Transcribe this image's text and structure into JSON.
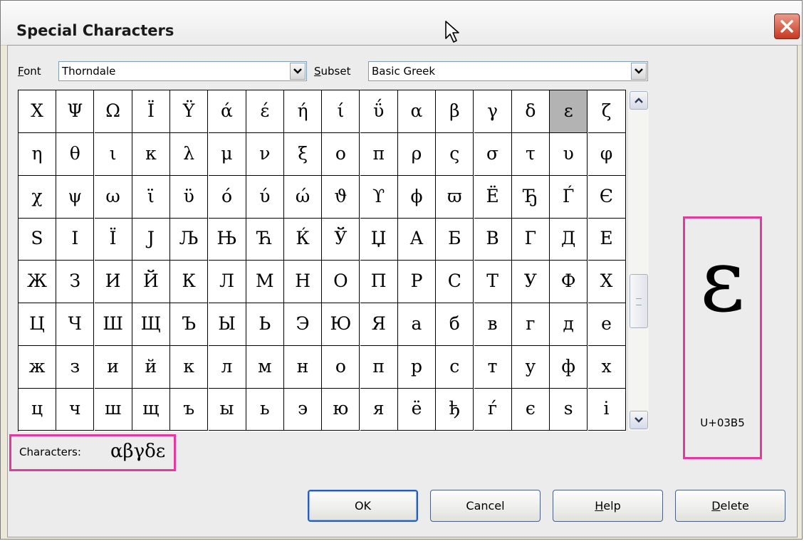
{
  "window": {
    "title": "Special Characters"
  },
  "font": {
    "label": "Font",
    "value": "Thorndale"
  },
  "subset": {
    "label": "Subset",
    "value": "Basic Greek"
  },
  "grid": {
    "rows": [
      [
        "Χ",
        "Ψ",
        "Ω",
        "Ϊ",
        "Ϋ",
        "ά",
        "έ",
        "ή",
        "ί",
        "ΰ",
        "α",
        "β",
        "γ",
        "δ",
        "ε",
        "ζ"
      ],
      [
        "η",
        "θ",
        "ι",
        "κ",
        "λ",
        "μ",
        "ν",
        "ξ",
        "ο",
        "π",
        "ρ",
        "ς",
        "σ",
        "τ",
        "υ",
        "φ"
      ],
      [
        "χ",
        "ψ",
        "ω",
        "ϊ",
        "ϋ",
        "ό",
        "ύ",
        "ώ",
        "ϑ",
        "ϒ",
        "ϕ",
        "ϖ",
        "Ё",
        "Ђ",
        "Ѓ",
        "Є"
      ],
      [
        "Ѕ",
        "І",
        "Ї",
        "Ј",
        "Љ",
        "Њ",
        "Ћ",
        "Ќ",
        "Ў",
        "Џ",
        "А",
        "Б",
        "В",
        "Г",
        "Д",
        "Е"
      ],
      [
        "Ж",
        "З",
        "И",
        "Й",
        "К",
        "Л",
        "М",
        "Н",
        "О",
        "П",
        "Р",
        "С",
        "Т",
        "У",
        "Ф",
        "Х"
      ],
      [
        "Ц",
        "Ч",
        "Ш",
        "Щ",
        "Ъ",
        "Ы",
        "Ь",
        "Э",
        "Ю",
        "Я",
        "а",
        "б",
        "в",
        "г",
        "д",
        "е"
      ],
      [
        "ж",
        "з",
        "и",
        "й",
        "к",
        "л",
        "м",
        "н",
        "о",
        "п",
        "р",
        "с",
        "т",
        "у",
        "ф",
        "х"
      ],
      [
        "ц",
        "ч",
        "ш",
        "щ",
        "ъ",
        "ы",
        "ь",
        "э",
        "ю",
        "я",
        "ё",
        "ђ",
        "ѓ",
        "є",
        "ѕ",
        "і"
      ]
    ],
    "selected": "ε"
  },
  "preview": {
    "glyph": "ε",
    "code": "U+03B5"
  },
  "characters": {
    "label": "Characters:",
    "value": "αβγδε"
  },
  "buttons": {
    "ok": "OK",
    "cancel": "Cancel",
    "help": "Help",
    "delete": "Delete"
  },
  "colors": {
    "highlight_frame": "#e6399b",
    "selected_cell": "#b3b3b3",
    "close_button": "#c8381f"
  },
  "icons": {
    "close": "close-icon",
    "cursor": "mouse-pointer-icon",
    "dropdown": "chevron-down-icon",
    "scroll_up": "scroll-up-icon",
    "scroll_down": "scroll-down-icon"
  }
}
